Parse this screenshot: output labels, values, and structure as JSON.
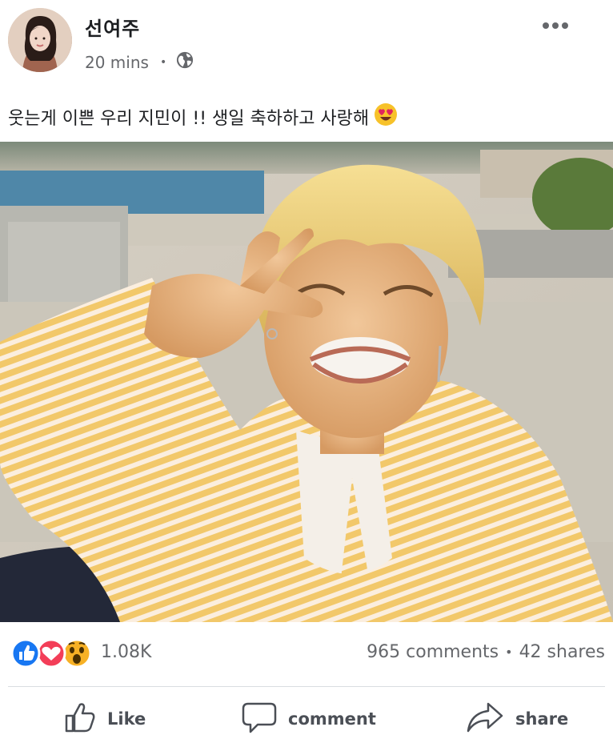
{
  "post": {
    "author": "선여주",
    "time": "20 mins",
    "separator": "•",
    "privacy_icon": "globe-icon",
    "more_icon": "more-horizontal-icon",
    "caption": "웃는게 이쁜 우리 지민이 !! 생일 축하하고 사랑해",
    "caption_emoji": "smiling-face-with-heart-eyes-icon",
    "photo_description": "photo of a person with yellow hair making a peace sign, wearing a yellow striped shirt"
  },
  "reactions": {
    "icons": [
      "like-icon",
      "love-icon",
      "wow-icon"
    ],
    "count": "1.08K",
    "comments": "965 comments",
    "separator": "•",
    "shares": "42 shares"
  },
  "actions": {
    "like": "Like",
    "comment": "comment",
    "share": "share"
  },
  "colors": {
    "like_blue": "#1877f2",
    "love_red": "#f33e58",
    "wow_yellow": "#f7b125",
    "secondary_text": "#65676b"
  }
}
